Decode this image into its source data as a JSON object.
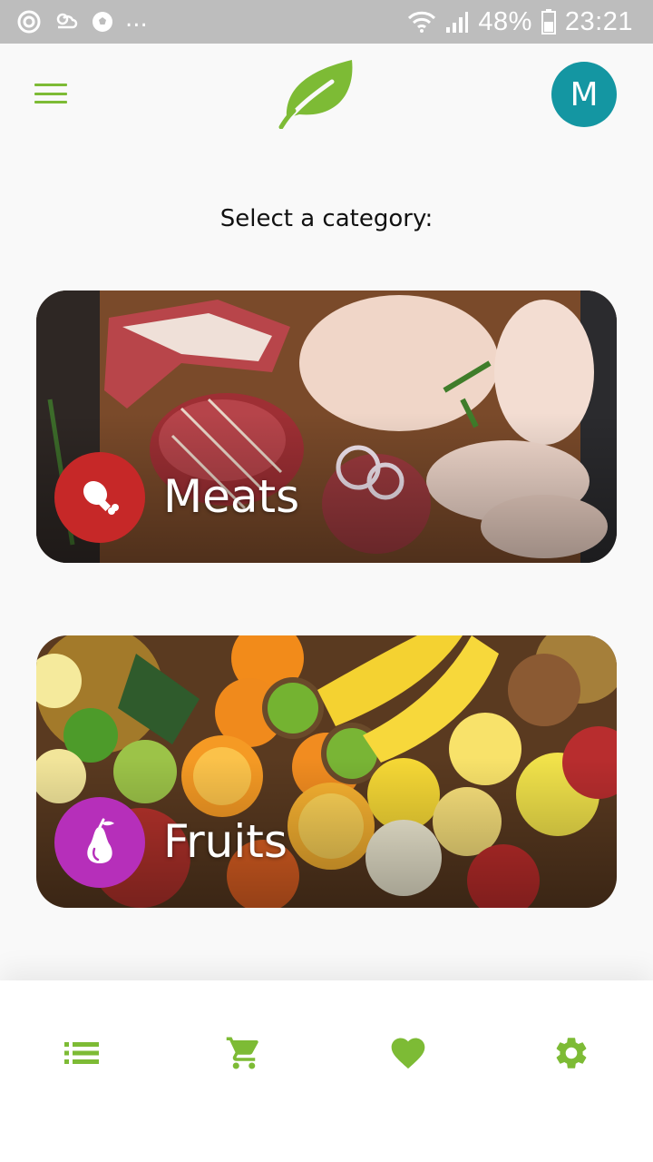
{
  "status_bar": {
    "overflow": "...",
    "battery": "48%",
    "time": "23:21"
  },
  "header": {
    "avatar_initial": "M",
    "brand_color": "#7dbb35"
  },
  "prompt": "Select a category:",
  "categories": [
    {
      "label": "Meats",
      "icon": "drumstick-icon",
      "icon_color": "#c62828"
    },
    {
      "label": "Fruits",
      "icon": "pear-icon",
      "icon_color": "#b62fba"
    }
  ],
  "bottom_nav": [
    {
      "icon": "list-icon"
    },
    {
      "icon": "cart-icon"
    },
    {
      "icon": "heart-icon"
    },
    {
      "icon": "gear-icon"
    }
  ]
}
